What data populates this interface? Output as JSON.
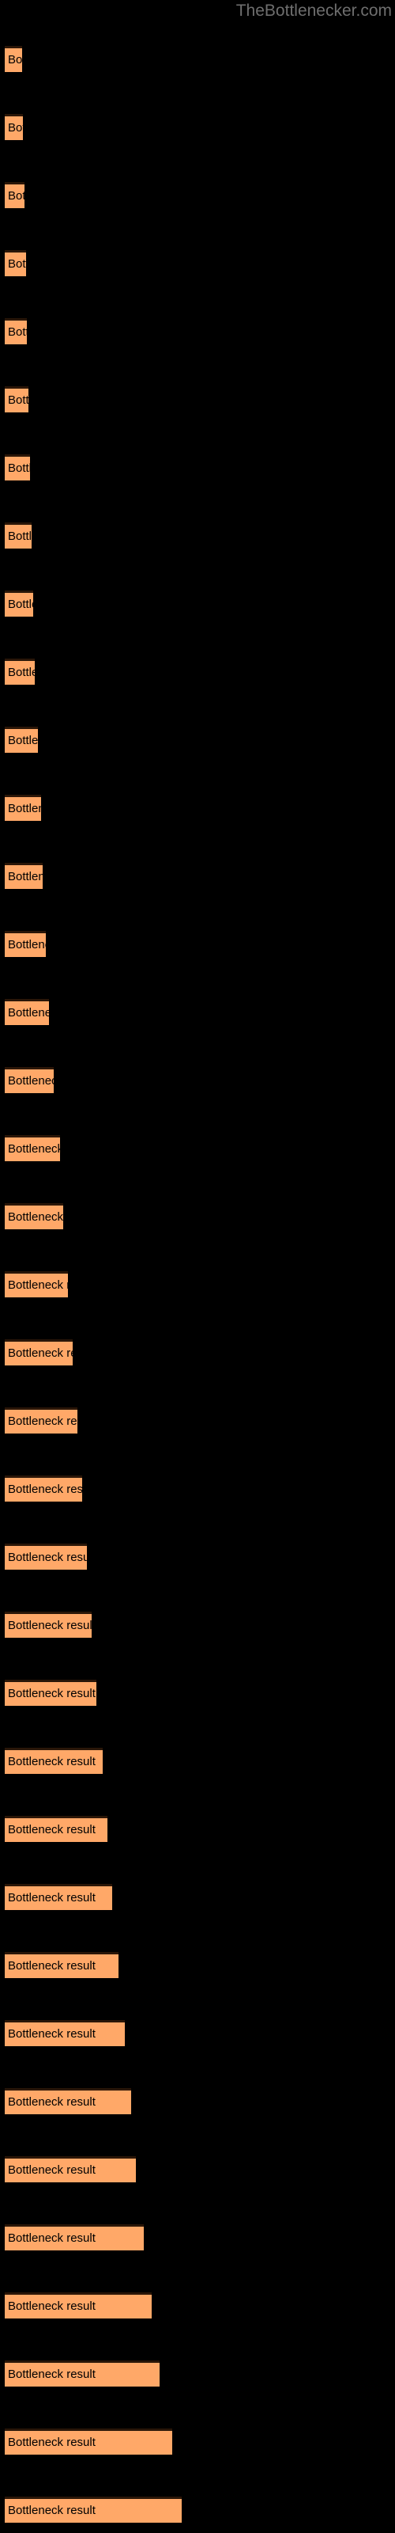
{
  "watermark": {
    "text": "TheBottlenecker.com",
    "color": "#6e6e6e"
  },
  "colors": {
    "background": "#000000",
    "bar_fill": "#FFA868",
    "bar_border_top": "#2a1608",
    "label_text": "#000000",
    "watermark_text": "#6e6e6e"
  },
  "chart_data": {
    "type": "bar",
    "orientation": "horizontal",
    "title": "TheBottlenecker.com",
    "xlabel": "",
    "ylabel": "",
    "grid": false,
    "legend": false,
    "bar_label_text": "Bottleneck result",
    "categories": [
      "Bottleneck result",
      "Bottleneck result",
      "Bottleneck result",
      "Bottleneck result",
      "Bottleneck result",
      "Bottleneck result",
      "Bottleneck result",
      "Bottleneck result",
      "Bottleneck result",
      "Bottleneck result",
      "Bottleneck result",
      "Bottleneck result",
      "Bottleneck result",
      "Bottleneck result",
      "Bottleneck result",
      "Bottleneck result",
      "Bottleneck result",
      "Bottleneck result",
      "Bottleneck result",
      "Bottleneck result",
      "Bottleneck result",
      "Bottleneck result",
      "Bottleneck result",
      "Bottleneck result",
      "Bottleneck result",
      "Bottleneck result",
      "Bottleneck result",
      "Bottleneck result",
      "Bottleneck result",
      "Bottleneck result",
      "Bottleneck result",
      "Bottleneck result",
      "Bottleneck result",
      "Bottleneck result",
      "Bottleneck result",
      "Bottleneck result",
      "Bottleneck result"
    ],
    "values": [
      22,
      23,
      25,
      27,
      28,
      30,
      32,
      34,
      36,
      38,
      42,
      46,
      48,
      52,
      56,
      62,
      70,
      74,
      80,
      86,
      92,
      98,
      104,
      110,
      116,
      124,
      130,
      136,
      144,
      152,
      160,
      166,
      176,
      186,
      196,
      212,
      224
    ],
    "bar_pixel_widths": [
      22,
      23,
      25,
      27,
      28,
      30,
      32,
      34,
      36,
      38,
      42,
      46,
      48,
      52,
      56,
      62,
      70,
      74,
      80,
      86,
      92,
      98,
      104,
      110,
      116,
      124,
      130,
      136,
      144,
      152,
      160,
      166,
      176,
      186,
      196,
      212,
      224
    ],
    "bar_pixel_tops": [
      58,
      144,
      230,
      316,
      402,
      488,
      574,
      660,
      746,
      832,
      918,
      1004,
      1090,
      1176,
      1262,
      1348,
      1434,
      1520,
      1606,
      1692,
      1778,
      1864,
      1950,
      2036,
      2122,
      2208,
      2294,
      2380,
      2466,
      2552,
      2638,
      2724,
      2810,
      2896,
      2982,
      3068,
      3154
    ],
    "xlim": [
      0,
      500
    ],
    "bar_count": 37
  }
}
